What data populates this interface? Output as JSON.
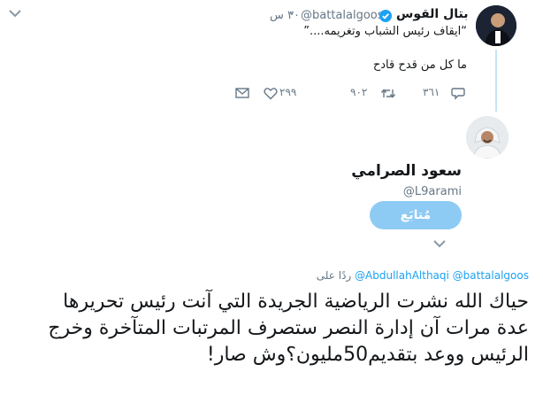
{
  "quoted_tweet": {
    "name": "بتال القوس",
    "handle": "@battalalgoos",
    "time": "٣٠ س",
    "quote_text": "“ايقاف رئيس الشباب وتغريمه....”",
    "reply_text": "ما كل من قدح قادح",
    "actions": {
      "reply_count": "٣٦١",
      "retweet_count": "٩٠٢",
      "like_count": "٢٩٩"
    }
  },
  "profile": {
    "name": "سعود الصرامي",
    "handle": "@L9arami",
    "follow_label": "مُتابَع"
  },
  "main_tweet": {
    "reply_to_prefix": "ردًا على",
    "reply_to_handles": "@AbdullahAlthaqi @battalalgoos",
    "text": "حياك الله نشرت الرياضية الجريدة التي آنت رئيس تحريرها عدة مرات آن إدارة النصر ستصرف المرتبات المتآخرة وخرج الرئيس ووعد بتقديم50مليون؟وش صار!"
  },
  "colors": {
    "accent": "#1da1f2",
    "follow_button": "#8ecbf4",
    "thread_line": "#c7e3f5",
    "muted": "#657786"
  }
}
